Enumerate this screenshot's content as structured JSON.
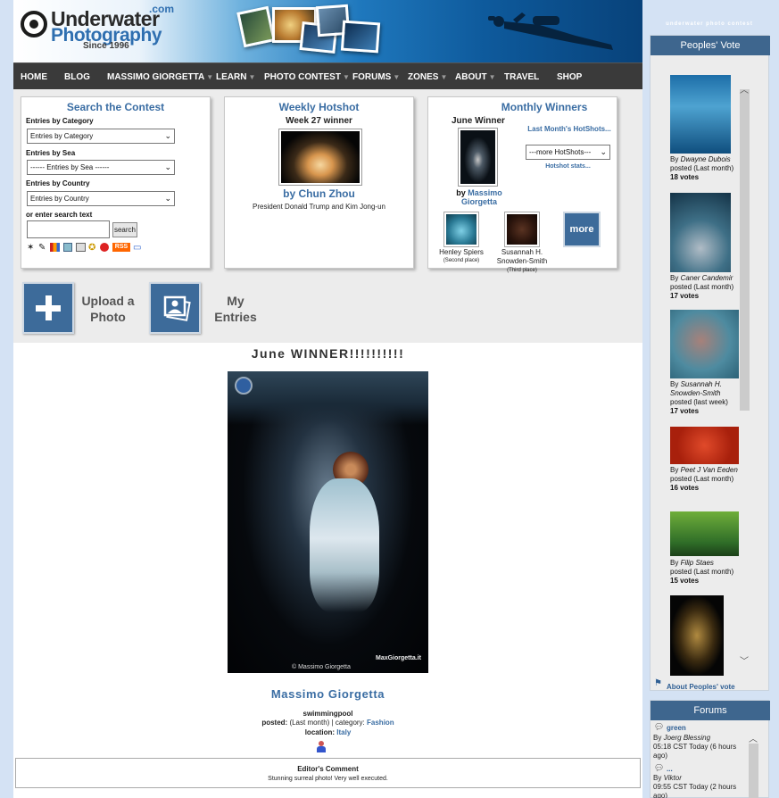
{
  "brand": {
    "logo_line1": "Underwater",
    "logo_line2": "Photography",
    "logo_com": ".com",
    "logo_since": "Since 1996"
  },
  "sidebar_caption": "underwater photo contest",
  "nav": [
    {
      "label": "HOME",
      "dropdown": false
    },
    {
      "label": "BLOG",
      "dropdown": false
    },
    {
      "label": "MASSIMO GIORGETTA",
      "dropdown": true
    },
    {
      "label": "LEARN",
      "dropdown": true
    },
    {
      "label": "PHOTO CONTEST",
      "dropdown": true
    },
    {
      "label": "FORUMS",
      "dropdown": true
    },
    {
      "label": "ZONES",
      "dropdown": true
    },
    {
      "label": "ABOUT",
      "dropdown": true
    },
    {
      "label": "TRAVEL",
      "dropdown": false
    },
    {
      "label": "SHOP",
      "dropdown": false
    }
  ],
  "search": {
    "title": "Search the Contest",
    "cat_label": "Entries by Category",
    "cat_value": "Entries by Category",
    "sea_label": "Entries by Sea",
    "sea_value": "------ Entries by Sea ------",
    "country_label": "Entries by Country",
    "country_value": "Entries by Country",
    "text_label": "or enter search text",
    "text_value": "",
    "button": "search",
    "rss": "RSS"
  },
  "hotshot": {
    "title": "Weekly Hotshot",
    "subtitle": "Week 27 winner",
    "author": "by Chun Zhou",
    "caption": "President Donald Trump and Kim Jong-un"
  },
  "monthly": {
    "title": "Monthly Winners",
    "subtitle": "June Winner",
    "by": "by",
    "winner": "Massimo Giorgetta",
    "last_month_link": "Last Month's HotShots...",
    "select_value": "---more HotShots---",
    "stats_link": "Hotshot stats...",
    "second_name": "Henley Spiers",
    "second_place": "(Second place)",
    "third_name": "Susannah H. Snowden-Smith",
    "third_place": "(Third place)",
    "more": "more"
  },
  "actions": {
    "upload": "Upload a Photo",
    "entries": "My Entries"
  },
  "feature": {
    "heading": "June WINNER!!!!!!!!!!",
    "credit": "© Massimo Giorgetta",
    "watermark": "MaxGiorgetta.it",
    "author": "Massimo Giorgetta",
    "title": "swimmingpool",
    "posted_label": "posted:",
    "posted_value": "(Last month) | category:",
    "category": "Fashion",
    "location_label": "location:",
    "location": "Italy",
    "comment_title": "Editor's Comment",
    "comment_text": "Stunning surreal photo! Very well executed."
  },
  "peoples_vote": {
    "title": "Peoples' Vote",
    "about": "About Peoples' vote",
    "items": [
      {
        "by": "By",
        "name": "Dwayne Dubois",
        "posted": "posted (Last month)",
        "votes": "18 votes"
      },
      {
        "by": "By",
        "name": "Caner Candemir",
        "posted": "posted (Last month)",
        "votes": "17 votes"
      },
      {
        "by": "By",
        "name": "Susannah H. Snowden-Smith",
        "posted": "posted (last week)",
        "votes": "17 votes"
      },
      {
        "by": "By",
        "name": "Peet J Van Eeden",
        "posted": "posted (Last month)",
        "votes": "16 votes"
      },
      {
        "by": "By",
        "name": "Filip Staes",
        "posted": "posted (Last month)",
        "votes": "15 votes"
      }
    ]
  },
  "forums": {
    "title": "Forums",
    "items": [
      {
        "topic": "green",
        "by": "By",
        "author": "Joerg Blessing",
        "time": "05:18 CST Today (6 hours ago)"
      },
      {
        "topic": "...",
        "by": "By",
        "author": "Viktor",
        "time": "09:55 CST Today (2 hours ago)"
      }
    ]
  },
  "colors": {
    "nav_bg": "#3a3a3a",
    "accent": "#3e668e",
    "link": "#2f5f94",
    "title": "#3a6da3"
  }
}
